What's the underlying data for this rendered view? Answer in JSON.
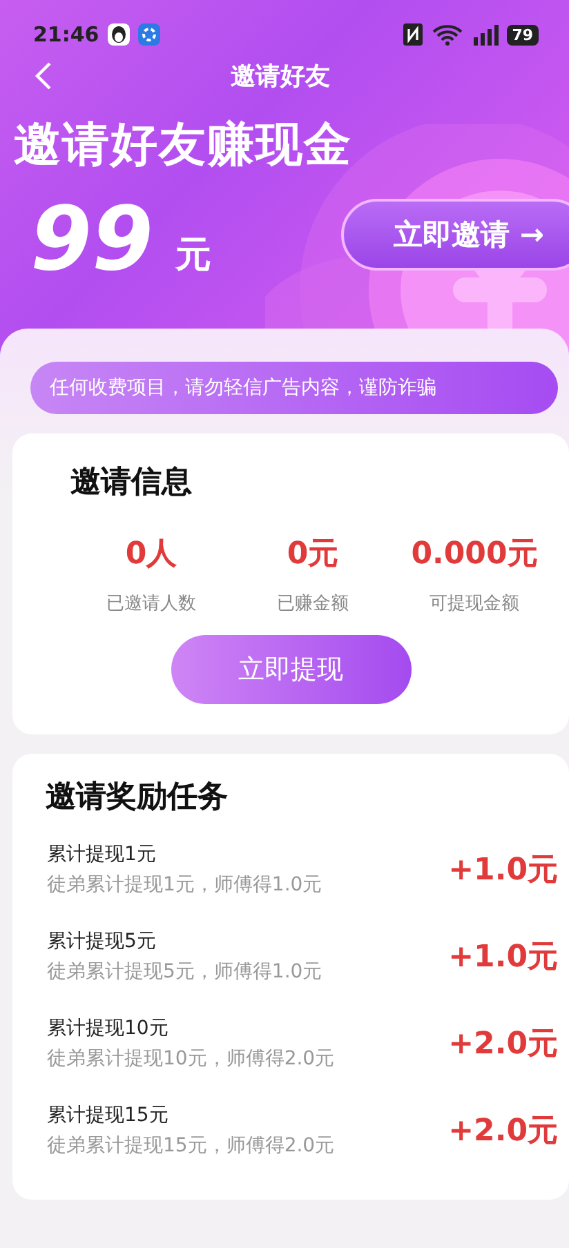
{
  "status_bar": {
    "time": "21:46",
    "battery": "79"
  },
  "nav": {
    "title": "邀请好友"
  },
  "hero": {
    "headline": "邀请好友赚现金",
    "amount": "99",
    "unit": "元",
    "invite_button": "立即邀请 →"
  },
  "notice": {
    "text": "任何收费项目，请勿轻信广告内容，谨防诈骗"
  },
  "invite_info": {
    "title": "邀请信息",
    "stats": [
      {
        "value": "0人",
        "label": "已邀请人数"
      },
      {
        "value": "0元",
        "label": "已赚金额"
      },
      {
        "value": "0.000元",
        "label": "可提现金额"
      }
    ],
    "withdraw_button": "立即提现"
  },
  "tasks": {
    "title": "邀请奖励任务",
    "items": [
      {
        "name": "累计提现1元",
        "detail": "徒弟累计提现1元，师傅得1.0元",
        "reward": "+1.0元"
      },
      {
        "name": "累计提现5元",
        "detail": "徒弟累计提现5元，师傅得1.0元",
        "reward": "+1.0元"
      },
      {
        "name": "累计提现10元",
        "detail": "徒弟累计提现10元，师傅得2.0元",
        "reward": "+2.0元"
      },
      {
        "name": "累计提现15元",
        "detail": "徒弟累计提现15元，师傅得2.0元",
        "reward": "+2.0元"
      }
    ]
  }
}
